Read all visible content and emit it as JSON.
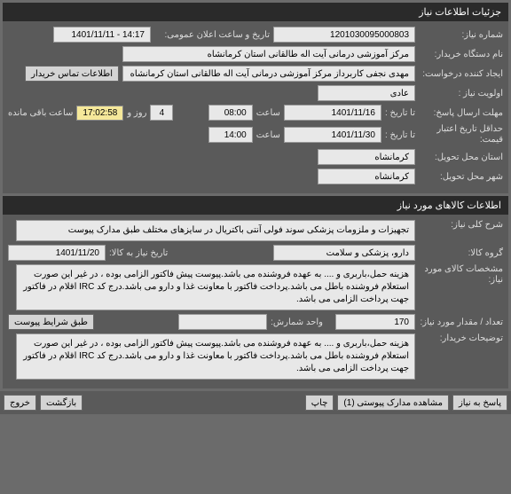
{
  "panel1": {
    "title": "جزئیات اطلاعات نیاز",
    "need_number_label": "شماره نیاز:",
    "need_number": "1201030095000803",
    "announce_date_label": "تاریخ و ساعت اعلان عمومی:",
    "announce_date": "14:17 - 1401/11/11",
    "device_name_label": "نام دستگاه خریدار:",
    "device_name": "مرکز آموزشی درمانی آیت اله طالقانی استان کرمانشاه",
    "requester_label": "ایجاد کننده درخواست:",
    "requester": "مهدی نجفی کاربرداز مرکز آموزشی درمانی آیت اله طالقانی استان کرمانشاه",
    "contact_btn": "اطلاعات تماس خریدار",
    "priority_label": "اولویت نیاز :",
    "priority": "عادی",
    "deadline_send_label": "مهلت ارسال پاسخ:",
    "deadline_send_to": "تا تاریخ :",
    "deadline_send_date": "1401/11/16",
    "deadline_send_time_label": "ساعت",
    "deadline_send_time": "08:00",
    "days_count": "4",
    "days_label": "روز و",
    "remaining_time": "17:02:58",
    "remaining_label": "ساعت باقی مانده",
    "validity_label": "حداقل تاریخ اعتبار قیمت:",
    "validity_to": "تا تاریخ :",
    "validity_date": "1401/11/30",
    "validity_time_label": "ساعت",
    "validity_time": "14:00",
    "delivery_province_label": "استان محل تحویل:",
    "delivery_province": "کرمانشاه",
    "delivery_city_label": "شهر محل تحویل:",
    "delivery_city": "کرمانشاه"
  },
  "panel2": {
    "title": "اطلاعات کالاهای مورد نیاز",
    "desc_label": "شرح کلی نیاز:",
    "desc": "تجهیزات و ملزومات پزشکی سوند فولی آنتی باکتریال در سایزهای مختلف طبق مدارک پیوست",
    "group_label": "گروه کالا:",
    "group": "دارو، پزشکی و سلامت",
    "need_date_label": "تاریخ نیاز به کالا:",
    "need_date": "1401/11/20",
    "spec_label": "مشخصات کالای مورد نیاز:",
    "spec": "هزینه حمل،باربری و .... به عهده فروشنده می باشد.پیوست پیش فاکتور الزامی بوده ، در غیر این صورت استعلام فروشنده باطل می باشد.پرداخت فاکتور با معاونت غذا و دارو می باشد.درج کد IRC اقلام در فاکتور جهت پرداخت الزامی می باشد.",
    "qty_label": "تعداد / مقدار مورد نیاز:",
    "qty": "170",
    "unit_label": "واحد شمارش:",
    "terms_btn": "طبق شرایط پیوست",
    "buyer_notes_label": "توضیحات خریدار:",
    "buyer_notes": "هزینه حمل،باربری و .... به عهده فروشنده می باشد.پیوست پیش فاکتور الزامی بوده ، در غیر این صورت استعلام فروشنده باطل می باشد.پرداخت فاکتور با معاونت غذا و دارو می باشد.درج کد IRC اقلام در فاکتور جهت پرداخت الزامی می باشد."
  },
  "buttons": {
    "respond": "پاسخ به نیاز",
    "attachments": "مشاهده مدارک پیوستی (1)",
    "print": "چاپ",
    "back": "بازگشت",
    "exit": "خروج"
  }
}
